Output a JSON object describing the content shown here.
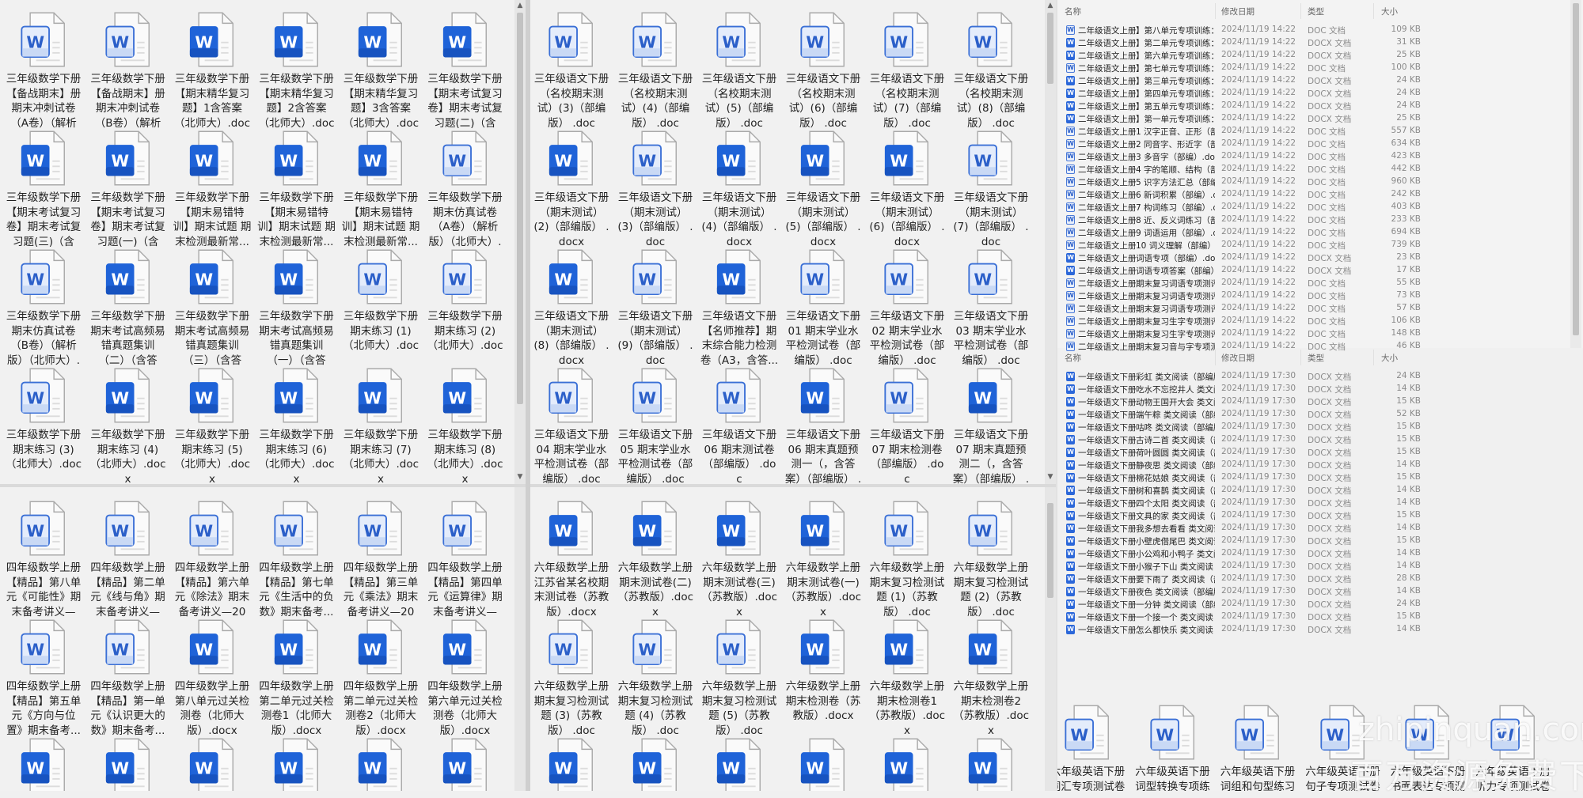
{
  "windows": {
    "left_top": {
      "items": [
        {
          "label": "三年级数学下册【备战期末】册期末冲刺试卷（A卷）（解析版...",
          "type": "doc"
        },
        {
          "label": "三年级数学下册【备战期末】册期末冲刺试卷（B卷）（解析版...",
          "type": "doc"
        },
        {
          "label": "三年级数学下册【期末精华复习题】1含答案（北师大）.docx",
          "type": "docx"
        },
        {
          "label": "三年级数学下册【期末精华复习题】2含答案（北师大）.docx",
          "type": "docx"
        },
        {
          "label": "三年级数学下册【期末精华复习题】3含答案（北师大）.docx",
          "type": "docx"
        },
        {
          "label": "三年级数学下册【期末考试复习卷】期末考试复习题(二)（含答...",
          "type": "docx"
        },
        {
          "label": "三年级数学下册【期末考试复习卷】期末考试复习题(三)（含答...",
          "type": "docx"
        },
        {
          "label": "三年级数学下册【期末考试复习卷】期末考试复习题(一)（含答...",
          "type": "docx"
        },
        {
          "label": "三年级数学下册【期末易错特训】期末试题 期末检测最新常...",
          "type": "docx"
        },
        {
          "label": "三年级数学下册【期末易错特训】期末试题 期末检测最新常...",
          "type": "docx"
        },
        {
          "label": "三年级数学下册【期末易错特训】期末试题 期末检测最新常...",
          "type": "docx"
        },
        {
          "label": "三年级数学下册期末仿真试卷（A卷）（解析版）（北师大）.doc",
          "type": "doc"
        },
        {
          "label": "三年级数学下册期末仿真试卷（B卷）（解析版）（北师大）.doc",
          "type": "doc"
        },
        {
          "label": "三年级数学下册期末考试高频易错真题集训（二）（含答案...",
          "type": "docx"
        },
        {
          "label": "三年级数学下册期末考试高频易错真题集训（三）（含答案...",
          "type": "docx"
        },
        {
          "label": "三年级数学下册期末考试高频易错真题集训（一）（含答案...",
          "type": "docx"
        },
        {
          "label": "三年级数学下册期末练习 (1)（北师大）.doc",
          "type": "doc"
        },
        {
          "label": "三年级数学下册期末练习 (2)（北师大）.doc",
          "type": "doc"
        },
        {
          "label": "三年级数学下册期末练习 (3)（北师大）.doc",
          "type": "doc"
        },
        {
          "label": "三年级数学下册期末练习 (4)（北师大）.docx",
          "type": "docx"
        },
        {
          "label": "三年级数学下册期末练习 (5)（北师大）.docx",
          "type": "docx"
        },
        {
          "label": "三年级数学下册期末练习 (6)（北师大）.docx",
          "type": "docx"
        },
        {
          "label": "三年级数学下册期末练习 (7)（北师大）.docx",
          "type": "docx"
        },
        {
          "label": "三年级数学下册期末练习 (8)（北师大）.docx",
          "type": "docx"
        }
      ]
    },
    "left_bottom": {
      "items": [
        {
          "label": "四年级数学上册【精品】第八单元《可能性》期末备考讲义—2...",
          "type": "doc"
        },
        {
          "label": "四年级数学上册【精品】第二单元《线与角》期末备考讲义—2...",
          "type": "doc"
        },
        {
          "label": "四年级数学上册【精品】第六单元《除法》期末备考讲义—202...",
          "type": "doc"
        },
        {
          "label": "四年级数学上册【精品】第七单元《生活中的负数》期末备考...",
          "type": "doc"
        },
        {
          "label": "四年级数学上册【精品】第三单元《乘法》期末备考讲义—202...",
          "type": "doc"
        },
        {
          "label": "四年级数学上册【精品】第四单元《运算律》期末备考讲义—2...",
          "type": "doc"
        },
        {
          "label": "四年级数学上册【精品】第五单元《方向与位置》期末备考...",
          "type": "doc"
        },
        {
          "label": "四年级数学上册【精品】第一单元《认识更大的数》期末备考...",
          "type": "doc"
        },
        {
          "label": "四年级数学上册第八单元过关检测卷（北师大版）.docx",
          "type": "docx"
        },
        {
          "label": "四年级数学上册第二单元过关检测卷1（北师大版）.docx",
          "type": "docx"
        },
        {
          "label": "四年级数学上册第二单元过关检测卷2（北师大版）.docx",
          "type": "docx"
        },
        {
          "label": "四年级数学上册第六单元过关检测卷（北师大版）.docx",
          "type": "docx"
        },
        {
          "label": "",
          "type": "docx"
        },
        {
          "label": "",
          "type": "docx"
        },
        {
          "label": "",
          "type": "docx"
        },
        {
          "label": "",
          "type": "docx"
        },
        {
          "label": "",
          "type": "docx"
        },
        {
          "label": "",
          "type": "docx"
        }
      ]
    },
    "middle_top": {
      "items": [
        {
          "label": "三年级语文下册（名校期末测试）(3)（部编版） .doc",
          "type": "doc"
        },
        {
          "label": "三年级语文下册（名校期末测试）(4)（部编版） .doc",
          "type": "doc"
        },
        {
          "label": "三年级语文下册（名校期末测试）(5)（部编版） .doc",
          "type": "doc"
        },
        {
          "label": "三年级语文下册（名校期末测试）(6)（部编版） .doc",
          "type": "doc"
        },
        {
          "label": "三年级语文下册（名校期末测试）(7)（部编版） .doc",
          "type": "doc"
        },
        {
          "label": "三年级语文下册（名校期末测试）(8)（部编版） .doc",
          "type": "doc"
        },
        {
          "label": "三年级语文下册（期末测试）(2)（部编版） .docx",
          "type": "docx"
        },
        {
          "label": "三年级语文下册（期末测试）(3)（部编版） .doc",
          "type": "doc"
        },
        {
          "label": "三年级语文下册（期末测试）(4)（部编版） .docx",
          "type": "docx"
        },
        {
          "label": "三年级语文下册（期末测试）(5)（部编版） .docx",
          "type": "docx"
        },
        {
          "label": "三年级语文下册（期末测试）(6)（部编版） .docx",
          "type": "docx"
        },
        {
          "label": "三年级语文下册（期末测试）(7)（部编版） .doc",
          "type": "doc"
        },
        {
          "label": "三年级语文下册（期末测试）(8)（部编版） .docx",
          "type": "docx"
        },
        {
          "label": "三年级语文下册（期末测试）(9)（部编版） .doc",
          "type": "doc"
        },
        {
          "label": "三年级语文下册【名师推荐】期末综合能力检测卷（A3，含答...",
          "type": "docx"
        },
        {
          "label": "三年级语文下册01 期末学业水平检测试卷（部编版） .doc",
          "type": "doc"
        },
        {
          "label": "三年级语文下册02 期末学业水平检测试卷（部编版） .doc",
          "type": "doc"
        },
        {
          "label": "三年级语文下册03 期末学业水平检测试卷（部编版） .doc",
          "type": "doc"
        },
        {
          "label": "三年级语文下册04 期末学业水平检测试卷（部编版） .doc",
          "type": "doc"
        },
        {
          "label": "三年级语文下册05 期末学业水平检测试卷（部编版） .doc",
          "type": "doc"
        },
        {
          "label": "三年级语文下册06 期末测试卷（部编版） .doc",
          "type": "doc"
        },
        {
          "label": "三年级语文下册06 期末真题预测一（，含答案）（部编版） .d...",
          "type": "docx"
        },
        {
          "label": "三年级语文下册07 期末检测卷（部编版） .doc",
          "type": "doc"
        },
        {
          "label": "三年级语文下册07 期末真题预测二（，含答案）（部编版） .d...",
          "type": "docx"
        }
      ]
    },
    "middle_bottom": {
      "items": [
        {
          "label": "六年级数学上册江苏省某名校期末测试卷（苏教版）.docx",
          "type": "docx"
        },
        {
          "label": "六年级数学上册期末测试卷(二)（苏教版）.docx",
          "type": "docx"
        },
        {
          "label": "六年级数学上册期末测试卷(三)（苏教版）.docx",
          "type": "docx"
        },
        {
          "label": "六年级数学上册期末测试卷(一)（苏教版）.docx",
          "type": "docx"
        },
        {
          "label": "六年级数学上册期末复习检测试题 (1)（苏教版） .doc",
          "type": "doc"
        },
        {
          "label": "六年级数学上册期末复习检测试题 (2)（苏教版） .doc",
          "type": "doc"
        },
        {
          "label": "六年级数学上册期末复习检测试题 (3)（苏教版） .doc",
          "type": "doc"
        },
        {
          "label": "六年级数学上册期末复习检测试题 (4)（苏教版） .doc",
          "type": "doc"
        },
        {
          "label": "六年级数学上册期末复习检测试题 (5)（苏教版） .doc",
          "type": "doc"
        },
        {
          "label": "六年级数学上册期末检测卷（苏教版）.docx",
          "type": "docx"
        },
        {
          "label": "六年级数学上册期末检测卷1（苏教版）.docx",
          "type": "docx"
        },
        {
          "label": "六年级数学上册期末检测卷2（苏教版）.docx",
          "type": "docx"
        },
        {
          "label": "",
          "type": "docx"
        },
        {
          "label": "",
          "type": "docx"
        },
        {
          "label": "",
          "type": "docx"
        },
        {
          "label": "",
          "type": "docx"
        },
        {
          "label": "",
          "type": "docx"
        },
        {
          "label": "",
          "type": "docx"
        }
      ]
    },
    "right_bottom": {
      "items": [
        {
          "label": "六年级英语下册词汇专项测试卷",
          "type": "doc"
        },
        {
          "label": "六年级英语下册词型转换专项练",
          "type": "doc"
        },
        {
          "label": "六年级英语下册词组和句型练习",
          "type": "doc"
        },
        {
          "label": "六年级英语下册句子专项测试卷",
          "type": "doc"
        },
        {
          "label": "六年级英语下册书面表达专项测",
          "type": "doc"
        },
        {
          "label": "六年级英语下册听力专项测试卷_",
          "type": "doc"
        }
      ]
    }
  },
  "list_headers": {
    "name": "名称",
    "date": "修改日期",
    "type": "类型",
    "size": "大小"
  },
  "list_top": [
    {
      "pre": "二年级语文上册",
      "rest": "】第八单元专项训练：...",
      "date": "2024/11/19 14:22",
      "type": "DOC 文档",
      "size": "109 KB",
      "icon": "doc"
    },
    {
      "pre": "二年级语文上册",
      "rest": "】第二单元专项训练：...",
      "date": "2024/11/19 14:22",
      "type": "DOCX 文档",
      "size": "31 KB",
      "icon": "docx"
    },
    {
      "pre": "二年级语文上册",
      "rest": "】第六单元专项训练：...",
      "date": "2024/11/19 14:22",
      "type": "DOCX 文档",
      "size": "25 KB",
      "icon": "docx"
    },
    {
      "pre": "二年级语文上册",
      "rest": "】第七单元专项训练：...",
      "date": "2024/11/19 14:22",
      "type": "DOC 文档",
      "size": "100 KB",
      "icon": "doc"
    },
    {
      "pre": "二年级语文上册",
      "rest": "】第三单元专项训练：...",
      "date": "2024/11/19 14:22",
      "type": "DOCX 文档",
      "size": "24 KB",
      "icon": "docx"
    },
    {
      "pre": "二年级语文上册",
      "rest": "】第四单元专项训练：...",
      "date": "2024/11/19 14:22",
      "type": "DOCX 文档",
      "size": "24 KB",
      "icon": "docx"
    },
    {
      "pre": "二年级语文上册",
      "rest": "】第五单元专项训练：...",
      "date": "2024/11/19 14:22",
      "type": "DOCX 文档",
      "size": "24 KB",
      "icon": "docx"
    },
    {
      "pre": "二年级语文上册",
      "rest": "】第一单元专项训练：...",
      "date": "2024/11/19 14:22",
      "type": "DOCX 文档",
      "size": "25 KB",
      "icon": "docx"
    },
    {
      "pre": "二年级语文上册",
      "rest": "1 汉字正音、正形（部...",
      "date": "2024/11/19 14:22",
      "type": "DOC 文档",
      "size": "557 KB",
      "icon": "doc"
    },
    {
      "pre": "二年级语文上册",
      "rest": "2 同音字、形近字（部...",
      "date": "2024/11/19 14:22",
      "type": "DOC 文档",
      "size": "634 KB",
      "icon": "doc"
    },
    {
      "pre": "二年级语文上册",
      "rest": "3 多音字（部编）.doc",
      "date": "2024/11/19 14:22",
      "type": "DOC 文档",
      "size": "423 KB",
      "icon": "doc"
    },
    {
      "pre": "二年级语文上册",
      "rest": "4 字的笔顺、结构（部...",
      "date": "2024/11/19 14:22",
      "type": "DOC 文档",
      "size": "442 KB",
      "icon": "doc"
    },
    {
      "pre": "二年级语文上册",
      "rest": "5 识字方法汇总（部编...",
      "date": "2024/11/19 14:22",
      "type": "DOC 文档",
      "size": "960 KB",
      "icon": "doc"
    },
    {
      "pre": "二年级语文上册",
      "rest": "6 新词积累（部编）.d...",
      "date": "2024/11/19 14:22",
      "type": "DOC 文档",
      "size": "242 KB",
      "icon": "doc"
    },
    {
      "pre": "二年级语文上册",
      "rest": "7 构词练习（部编）.d...",
      "date": "2024/11/19 14:22",
      "type": "DOC 文档",
      "size": "403 KB",
      "icon": "doc"
    },
    {
      "pre": "二年级语文上册",
      "rest": "8 近、反义词练习（部...",
      "date": "2024/11/19 14:22",
      "type": "DOC 文档",
      "size": "233 KB",
      "icon": "doc"
    },
    {
      "pre": "二年级语文上册",
      "rest": "9 词语运用（部编）.d...",
      "date": "2024/11/19 14:22",
      "type": "DOC 文档",
      "size": "694 KB",
      "icon": "doc"
    },
    {
      "pre": "二年级语文上册",
      "rest": "10 词义理解（部编）...",
      "date": "2024/11/19 14:22",
      "type": "DOC 文档",
      "size": "739 KB",
      "icon": "doc"
    },
    {
      "pre": "二年级语文上册",
      "rest": "词语专项（部编）.docx",
      "date": "2024/11/19 14:22",
      "type": "DOCX 文档",
      "size": "23 KB",
      "icon": "docx"
    },
    {
      "pre": "二年级语文上册",
      "rest": "词语专项答案（部编）...",
      "date": "2024/11/19 14:22",
      "type": "DOCX 文档",
      "size": "17 KB",
      "icon": "docx"
    },
    {
      "pre": "二年级语文上册",
      "rest": "期末复习词语专项测评...",
      "date": "2024/11/19 14:22",
      "type": "DOC 文档",
      "size": "55 KB",
      "icon": "doc"
    },
    {
      "pre": "二年级语文上册",
      "rest": "期末复习词语专项测评...",
      "date": "2024/11/19 14:22",
      "type": "DOC 文档",
      "size": "73 KB",
      "icon": "doc"
    },
    {
      "pre": "二年级语文上册",
      "rest": "期末复习词语专项测评...",
      "date": "2024/11/19 14:22",
      "type": "DOC 文档",
      "size": "57 KB",
      "icon": "doc"
    },
    {
      "pre": "二年级语文上册",
      "rest": "期末复习生字专项测评...",
      "date": "2024/11/19 14:22",
      "type": "DOC 文档",
      "size": "106 KB",
      "icon": "doc"
    },
    {
      "pre": "二年级语文上册",
      "rest": "期末复习生字专项测评...",
      "date": "2024/11/19 14:22",
      "type": "DOC 文档",
      "size": "148 KB",
      "icon": "doc"
    },
    {
      "pre": "二年级语文上册",
      "rest": "期末复习音与字专项测...",
      "date": "2024/11/19 14:22",
      "type": "DOC 文档",
      "size": "46 KB",
      "icon": "doc"
    }
  ],
  "list_bottom": [
    {
      "pre": "一年级语文下册",
      "rest": "彩虹 类文阅读（部编版...",
      "date": "2024/11/19 17:30",
      "type": "DOCX 文档",
      "size": "24 KB",
      "icon": "docx"
    },
    {
      "pre": "一年级语文下册",
      "rest": "吃水不忘挖井人 类文阅...",
      "date": "2024/11/19 17:30",
      "type": "DOCX 文档",
      "size": "14 KB",
      "icon": "docx"
    },
    {
      "pre": "一年级语文下册",
      "rest": "动物王国开大会 类文阅...",
      "date": "2024/11/19 17:30",
      "type": "DOCX 文档",
      "size": "15 KB",
      "icon": "docx"
    },
    {
      "pre": "一年级语文下册",
      "rest": "端午粽 类文阅读（部编...",
      "date": "2024/11/19 17:30",
      "type": "DOCX 文档",
      "size": "52 KB",
      "icon": "docx"
    },
    {
      "pre": "一年级语文下册",
      "rest": "咕咚 类文阅读（部编版...",
      "date": "2024/11/19 17:30",
      "type": "DOCX 文档",
      "size": "15 KB",
      "icon": "docx"
    },
    {
      "pre": "一年级语文下册",
      "rest": "古诗二首 类文阅读（部...",
      "date": "2024/11/19 17:30",
      "type": "DOCX 文档",
      "size": "15 KB",
      "icon": "docx"
    },
    {
      "pre": "一年级语文下册",
      "rest": "荷叶圆圆 类文阅读（部...",
      "date": "2024/11/19 17:30",
      "type": "DOCX 文档",
      "size": "15 KB",
      "icon": "docx"
    },
    {
      "pre": "一年级语文下册",
      "rest": "静夜思 类文阅读（部编...",
      "date": "2024/11/19 17:30",
      "type": "DOCX 文档",
      "size": "14 KB",
      "icon": "docx"
    },
    {
      "pre": "一年级语文下册",
      "rest": "棉花姑娘 类文阅读（部...",
      "date": "2024/11/19 17:30",
      "type": "DOCX 文档",
      "size": "15 KB",
      "icon": "docx"
    },
    {
      "pre": "一年级语文下册",
      "rest": "树和喜鹊 类文阅读（部...",
      "date": "2024/11/19 17:30",
      "type": "DOCX 文档",
      "size": "14 KB",
      "icon": "docx"
    },
    {
      "pre": "一年级语文下册",
      "rest": "四个太阳 类文阅读（部...",
      "date": "2024/11/19 17:30",
      "type": "DOCX 文档",
      "size": "14 KB",
      "icon": "docx"
    },
    {
      "pre": "一年级语文下册",
      "rest": "文具的家 类文阅读（部...",
      "date": "2024/11/19 17:30",
      "type": "DOCX 文档",
      "size": "15 KB",
      "icon": "docx"
    },
    {
      "pre": "一年级语文下册",
      "rest": "我多想去看看 类文阅读...",
      "date": "2024/11/19 17:30",
      "type": "DOCX 文档",
      "size": "14 KB",
      "icon": "docx"
    },
    {
      "pre": "一年级语文下册",
      "rest": "小壁虎借尾巴 类文阅读...",
      "date": "2024/11/19 17:30",
      "type": "DOCX 文档",
      "size": "15 KB",
      "icon": "docx"
    },
    {
      "pre": "一年级语文下册",
      "rest": "小公鸡和小鸭子 类文阅...",
      "date": "2024/11/19 17:30",
      "type": "DOCX 文档",
      "size": "14 KB",
      "icon": "docx"
    },
    {
      "pre": "一年级语文下册",
      "rest": "小猴子下山 类文阅读（...",
      "date": "2024/11/19 17:30",
      "type": "DOCX 文档",
      "size": "14 KB",
      "icon": "docx"
    },
    {
      "pre": "一年级语文下册",
      "rest": "要下雨了 类文阅读（部...",
      "date": "2024/11/19 17:30",
      "type": "DOCX 文档",
      "size": "28 KB",
      "icon": "docx"
    },
    {
      "pre": "一年级语文下册",
      "rest": "夜色 类文阅读（部编版...",
      "date": "2024/11/19 17:30",
      "type": "DOCX 文档",
      "size": "14 KB",
      "icon": "docx"
    },
    {
      "pre": "一年级语文下册",
      "rest": "一分钟 类文阅读（部编...",
      "date": "2024/11/19 17:30",
      "type": "DOCX 文档",
      "size": "24 KB",
      "icon": "docx"
    },
    {
      "pre": "一年级语文下册",
      "rest": "一个接一个 类文阅读（...",
      "date": "2024/11/19 17:30",
      "type": "DOCX 文档",
      "size": "15 KB",
      "icon": "docx"
    },
    {
      "pre": "一年级语文下册",
      "rest": "怎么都快乐 类文阅读（...",
      "date": "2024/11/19 17:30",
      "type": "DOCX 文档",
      "size": "14 KB",
      "icon": "docx"
    }
  ],
  "watermark": {
    "line1": "zhipinquan.com",
    "line2": "百万资源免费下载"
  },
  "colors": {
    "docx_blue": "#1f63d8",
    "doc_outline": "#3a6fd6",
    "doc_fill": "#e4ecfb",
    "bg": "#f0f0f0"
  }
}
